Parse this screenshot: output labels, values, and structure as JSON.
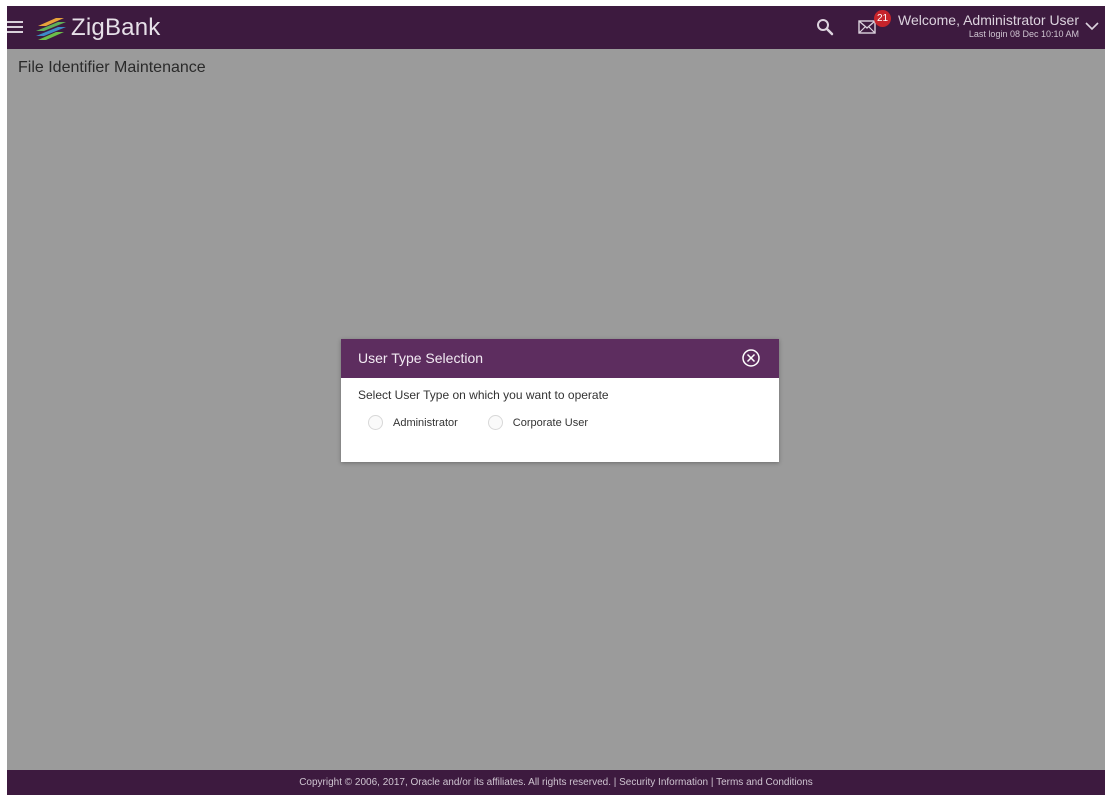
{
  "header": {
    "app_name": "ZigBank",
    "mail_badge_count": "21",
    "welcome_text": "Welcome, Administrator User",
    "last_login": "Last login 08 Dec 10:10 AM"
  },
  "page": {
    "title": "File Identifier Maintenance"
  },
  "modal": {
    "title": "User Type Selection",
    "prompt": "Select User Type on which you want to operate",
    "options": [
      {
        "label": "Administrator",
        "selected": false
      },
      {
        "label": "Corporate User",
        "selected": false
      }
    ]
  },
  "footer": {
    "copyright": "Copyright © 2006, 2017, Oracle and/or its affiliates. All rights reserved. |",
    "security_link": "Security Information",
    "separator": "|",
    "terms_link": "Terms and Conditions"
  },
  "colors": {
    "header_bg": "#3d1a3f",
    "modal_header_bg": "#5d2d5f",
    "overlay_bg": "#9b9b9b",
    "badge_bg": "#c6242b"
  },
  "icons": [
    "menu-icon",
    "zigbank-logo",
    "search-icon",
    "mail-icon",
    "chevron-down-icon",
    "close-icon"
  ]
}
